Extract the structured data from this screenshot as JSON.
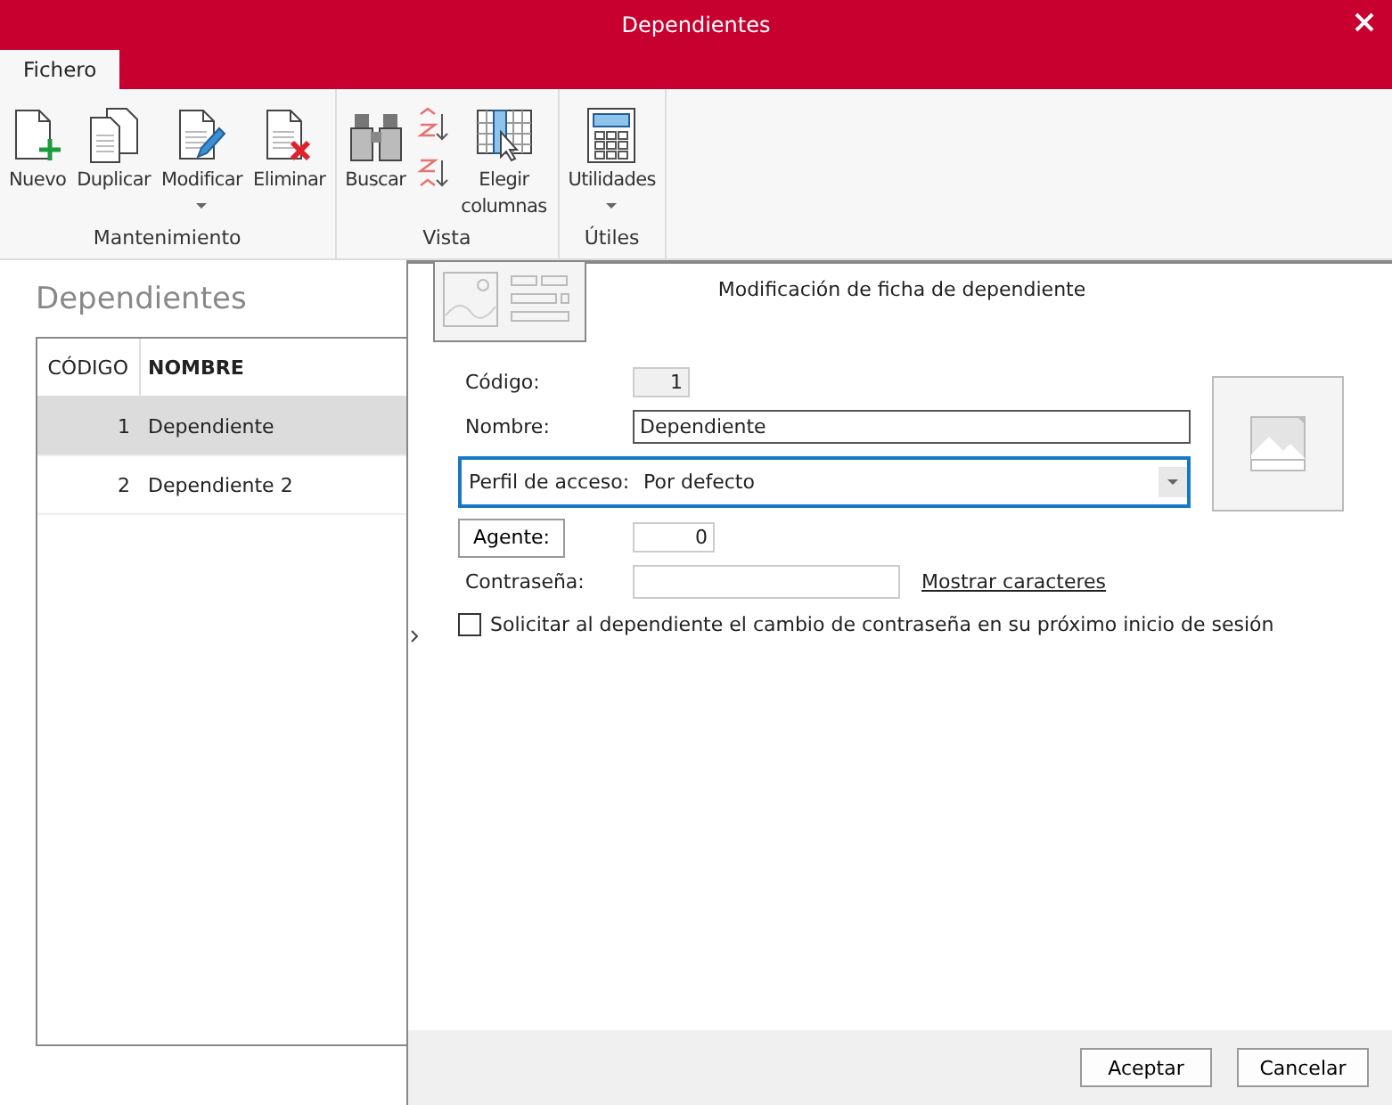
{
  "window": {
    "title": "Dependientes"
  },
  "tabs": [
    {
      "label": "Fichero",
      "selected": true
    }
  ],
  "ribbon": [
    {
      "label": "Mantenimiento",
      "buttons": [
        {
          "label": "Nuevo",
          "kind": "new",
          "dropdown": false
        },
        {
          "label": "Duplicar",
          "kind": "duplicate",
          "dropdown": false
        },
        {
          "label": "Modificar",
          "kind": "edit",
          "dropdown": true
        },
        {
          "label": "Eliminar",
          "kind": "delete",
          "dropdown": false
        }
      ]
    },
    {
      "label": "Vista",
      "buttons": [
        {
          "label": "Buscar",
          "kind": "find",
          "dropdown": false
        },
        {
          "kind": "sort",
          "dropdown": false
        },
        {
          "label": "Elegir columnas",
          "kind": "columns",
          "dropdown": false
        }
      ]
    },
    {
      "label": "Útiles",
      "buttons": [
        {
          "label": "Utilidades",
          "kind": "calculator",
          "dropdown": true
        }
      ]
    }
  ],
  "list": {
    "title": "Dependientes",
    "columns": [
      "CÓDIGO",
      "NOMBRE"
    ],
    "rows": [
      {
        "code": "1",
        "name": "Dependiente",
        "selected": true
      },
      {
        "code": "2",
        "name": "Dependiente 2",
        "selected": false
      }
    ]
  },
  "dialog": {
    "title": "Modificación de ficha de dependiente",
    "code": {
      "label": "Código:",
      "value": "1"
    },
    "name": {
      "label": "Nombre:",
      "value": "Dependiente"
    },
    "profile": {
      "label": "Perfil de acceso:",
      "value": "Por defecto"
    },
    "agent": {
      "label": "Agente:",
      "value": "0"
    },
    "password": {
      "label": "Contraseña:",
      "link": "Mostrar caracteres"
    },
    "force_change": {
      "label": "Solicitar al dependiente el cambio de contraseña en su próximo inicio de sesión",
      "checked": false
    },
    "buttons": [
      "Aceptar",
      "Cancelar"
    ]
  }
}
